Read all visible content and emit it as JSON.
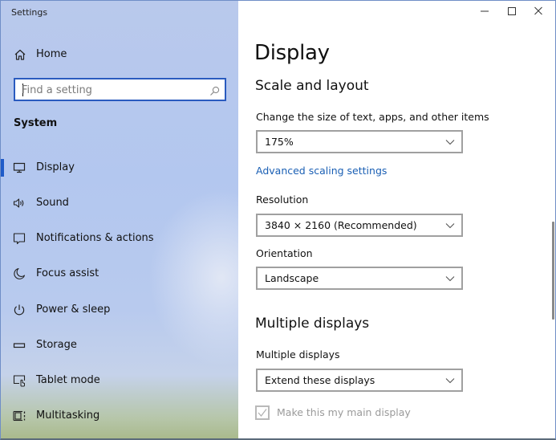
{
  "window": {
    "title": "Settings",
    "controls": {
      "minimize": "minimize",
      "maximize": "maximize",
      "close": "close"
    }
  },
  "sidebar": {
    "home_label": "Home",
    "search": {
      "placeholder": "Find a setting",
      "value": ""
    },
    "section_label": "System",
    "items": [
      {
        "label": "Display",
        "icon": "monitor-icon",
        "active": true
      },
      {
        "label": "Sound",
        "icon": "speaker-icon",
        "active": false
      },
      {
        "label": "Notifications & actions",
        "icon": "notification-icon",
        "active": false
      },
      {
        "label": "Focus assist",
        "icon": "moon-icon",
        "active": false
      },
      {
        "label": "Power & sleep",
        "icon": "power-icon",
        "active": false
      },
      {
        "label": "Storage",
        "icon": "storage-icon",
        "active": false
      },
      {
        "label": "Tablet mode",
        "icon": "tablet-mode-icon",
        "active": false
      },
      {
        "label": "Multitasking",
        "icon": "multitasking-icon",
        "active": false
      }
    ]
  },
  "main": {
    "page_title": "Display",
    "scale_section": {
      "heading": "Scale and layout",
      "scale_label": "Change the size of text, apps, and other items",
      "scale_value": "175%",
      "advanced_link": "Advanced scaling settings",
      "resolution_label": "Resolution",
      "resolution_value": "3840 × 2160 (Recommended)",
      "orientation_label": "Orientation",
      "orientation_value": "Landscape"
    },
    "multiple_section": {
      "heading": "Multiple displays",
      "label": "Multiple displays",
      "value": "Extend these displays",
      "main_display_checkbox": {
        "label": "Make this my main display",
        "checked": true,
        "disabled": true
      }
    }
  },
  "colors": {
    "accent": "#1f5bc8",
    "link": "#1a5fb4",
    "search_border": "#2a5bbf",
    "disabled_text": "#9a9a9a"
  }
}
